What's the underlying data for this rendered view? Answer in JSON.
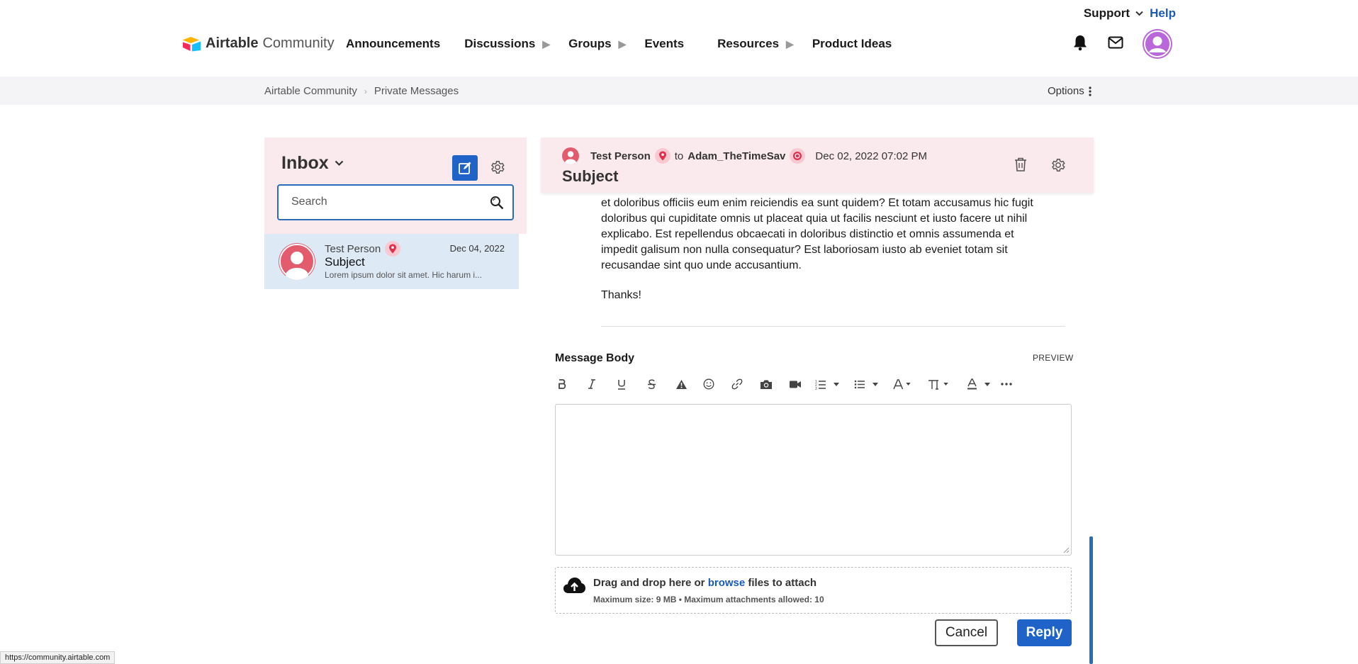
{
  "header": {
    "logo_brand": "Airtable",
    "logo_suffix": "Community",
    "support_label": "Support",
    "help_label": "Help",
    "nav": [
      {
        "label": "Announcements",
        "has_submenu": false
      },
      {
        "label": "Discussions",
        "has_submenu": true
      },
      {
        "label": "Groups",
        "has_submenu": true
      },
      {
        "label": "Events",
        "has_submenu": false
      },
      {
        "label": "Resources",
        "has_submenu": true
      },
      {
        "label": "Product Ideas",
        "has_submenu": false
      }
    ],
    "icons": [
      "bell-icon",
      "mail-icon",
      "user-avatar"
    ]
  },
  "breadcrumb": {
    "items": [
      "Airtable Community",
      "Private Messages"
    ],
    "options_label": "Options"
  },
  "inbox": {
    "title": "Inbox",
    "search_placeholder": "Search",
    "messages": [
      {
        "sender": "Test Person",
        "date": "Dec 04, 2022",
        "subject": "Subject",
        "preview": "Lorem ipsum dolor sit amet. Hic harum i..."
      }
    ]
  },
  "thread": {
    "from": "Test Person",
    "to_word": "to",
    "to": "Adam_TheTimeSav",
    "datetime": "Dec 02, 2022 07:02 PM",
    "subject": "Subject",
    "body": "et doloribus officiis eum enim reiciendis ea sunt quidem? Et totam accusamus hic fugit doloribus qui cupiditate omnis ut placeat quia ut facilis nesciunt et iusto facere ut nihil explicabo. Est repellendus obcaecati in doloribus distinctio et omnis assumenda et impedit galisum non nulla consequatur? Est laboriosam iusto ab eveniet totam sit recusandae sint quo unde accusantium.",
    "signoff": "Thanks!"
  },
  "reply": {
    "label": "Message Body",
    "preview_label": "PREVIEW",
    "editor_value": "",
    "attach_prefix": "Drag and drop here or ",
    "attach_link": "browse",
    "attach_suffix": " files to attach",
    "attach_limits": "Maximum size: 9 MB • Maximum attachments allowed: 10",
    "cancel_label": "Cancel",
    "reply_label": "Reply"
  },
  "status_bar": {
    "url": "https://community.airtable.com"
  },
  "colors": {
    "accent": "#1f63c8",
    "link": "#1a5bb8",
    "panel_pink": "#fbeaed",
    "selected_blue": "#dde9f5",
    "avatar_red": "#e35c6e",
    "user_avatar_purple": "#b868d8"
  }
}
